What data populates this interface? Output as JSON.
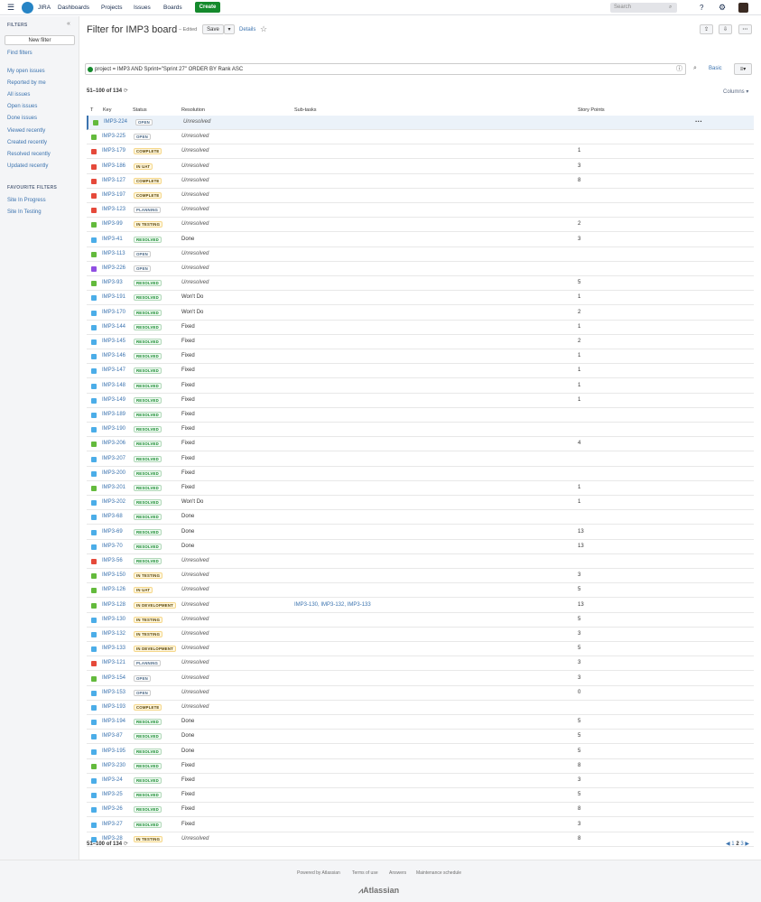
{
  "topnav": {
    "app_name": "JIRA",
    "dashboards": "Dashboards",
    "projects": "Projects",
    "issues": "Issues",
    "boards": "Boards",
    "create": "Create",
    "search_placeholder": "Search"
  },
  "sidebar": {
    "heading": "FILTERS",
    "new_filter": "New filter",
    "find_filters": "Find filters",
    "items": [
      "My open issues",
      "Reported by me",
      "All issues",
      "Open issues",
      "Done issues",
      "Viewed recently",
      "Created recently",
      "Resolved recently",
      "Updated recently"
    ],
    "fav_heading": "FAVOURITE FILTERS",
    "favourites": [
      "Site In Progress",
      "Site In Testing"
    ]
  },
  "main": {
    "title": "Filter for IMP3 board",
    "edited": "– Edited",
    "save": "Save",
    "details": "Details",
    "jql": "project = IMP3 AND Sprint=\"Sprint 27\" ORDER BY Rank ASC",
    "basic": "Basic",
    "count": "51–100 of 134",
    "columns": "Columns",
    "headers": {
      "t": "T",
      "key": "Key",
      "status": "Status",
      "resolution": "Resolution",
      "subtasks": "Sub-tasks",
      "story_points": "Story Points"
    }
  },
  "colors": {
    "story": "#63ba3c",
    "bug": "#e5493a",
    "task": "#4bade8",
    "epic": "#904ee2"
  },
  "rows": [
    {
      "type": "story",
      "key": "IMP3-224",
      "status": "OPEN",
      "resolution": "Unresolved",
      "sub": "",
      "sp": ""
    },
    {
      "type": "story",
      "key": "IMP3-225",
      "status": "OPEN",
      "resolution": "Unresolved",
      "sub": "",
      "sp": ""
    },
    {
      "type": "bug",
      "key": "IMP3-179",
      "status": "COMPLETE",
      "resolution": "Unresolved",
      "sub": "",
      "sp": "1"
    },
    {
      "type": "bug",
      "key": "IMP3-186",
      "status": "IN UAT",
      "resolution": "Unresolved",
      "sub": "",
      "sp": "3"
    },
    {
      "type": "bug",
      "key": "IMP3-127",
      "status": "COMPLETE",
      "resolution": "Unresolved",
      "sub": "",
      "sp": "8"
    },
    {
      "type": "bug",
      "key": "IMP3-197",
      "status": "COMPLETE",
      "resolution": "Unresolved",
      "sub": "",
      "sp": ""
    },
    {
      "type": "bug",
      "key": "IMP3-123",
      "status": "PLANNING",
      "resolution": "Unresolved",
      "sub": "",
      "sp": ""
    },
    {
      "type": "story",
      "key": "IMP3-99",
      "status": "IN TESTING",
      "resolution": "Unresolved",
      "sub": "",
      "sp": "2"
    },
    {
      "type": "task",
      "key": "IMP3-41",
      "status": "RESOLVED",
      "resolution": "Done",
      "sub": "",
      "sp": "3"
    },
    {
      "type": "story",
      "key": "IMP3-113",
      "status": "OPEN",
      "resolution": "Unresolved",
      "sub": "",
      "sp": ""
    },
    {
      "type": "epic",
      "key": "IMP3-226",
      "status": "OPEN",
      "resolution": "Unresolved",
      "sub": "",
      "sp": ""
    },
    {
      "type": "story",
      "key": "IMP3-93",
      "status": "RESOLVED",
      "resolution": "Unresolved",
      "sub": "",
      "sp": "5"
    },
    {
      "type": "task",
      "key": "IMP3-191",
      "status": "RESOLVED",
      "resolution": "Won't Do",
      "sub": "",
      "sp": "1"
    },
    {
      "type": "task",
      "key": "IMP3-170",
      "status": "RESOLVED",
      "resolution": "Won't Do",
      "sub": "",
      "sp": "2"
    },
    {
      "type": "task",
      "key": "IMP3-144",
      "status": "RESOLVED",
      "resolution": "Fixed",
      "sub": "",
      "sp": "1"
    },
    {
      "type": "task",
      "key": "IMP3-145",
      "status": "RESOLVED",
      "resolution": "Fixed",
      "sub": "",
      "sp": "2"
    },
    {
      "type": "task",
      "key": "IMP3-146",
      "status": "RESOLVED",
      "resolution": "Fixed",
      "sub": "",
      "sp": "1"
    },
    {
      "type": "task",
      "key": "IMP3-147",
      "status": "RESOLVED",
      "resolution": "Fixed",
      "sub": "",
      "sp": "1"
    },
    {
      "type": "task",
      "key": "IMP3-148",
      "status": "RESOLVED",
      "resolution": "Fixed",
      "sub": "",
      "sp": "1"
    },
    {
      "type": "task",
      "key": "IMP3-149",
      "status": "RESOLVED",
      "resolution": "Fixed",
      "sub": "",
      "sp": "1"
    },
    {
      "type": "task",
      "key": "IMP3-189",
      "status": "RESOLVED",
      "resolution": "Fixed",
      "sub": "",
      "sp": ""
    },
    {
      "type": "task",
      "key": "IMP3-190",
      "status": "RESOLVED",
      "resolution": "Fixed",
      "sub": "",
      "sp": ""
    },
    {
      "type": "story",
      "key": "IMP3-206",
      "status": "RESOLVED",
      "resolution": "Fixed",
      "sub": "",
      "sp": "4"
    },
    {
      "type": "task",
      "key": "IMP3-207",
      "status": "RESOLVED",
      "resolution": "Fixed",
      "sub": "",
      "sp": ""
    },
    {
      "type": "task",
      "key": "IMP3-200",
      "status": "RESOLVED",
      "resolution": "Fixed",
      "sub": "",
      "sp": ""
    },
    {
      "type": "story",
      "key": "IMP3-201",
      "status": "RESOLVED",
      "resolution": "Fixed",
      "sub": "",
      "sp": "1"
    },
    {
      "type": "task",
      "key": "IMP3-202",
      "status": "RESOLVED",
      "resolution": "Won't Do",
      "sub": "",
      "sp": "1"
    },
    {
      "type": "task",
      "key": "IMP3-68",
      "status": "RESOLVED",
      "resolution": "Done",
      "sub": "",
      "sp": ""
    },
    {
      "type": "task",
      "key": "IMP3-69",
      "status": "RESOLVED",
      "resolution": "Done",
      "sub": "",
      "sp": "13"
    },
    {
      "type": "task",
      "key": "IMP3-70",
      "status": "RESOLVED",
      "resolution": "Done",
      "sub": "",
      "sp": "13"
    },
    {
      "type": "bug",
      "key": "IMP3-56",
      "status": "RESOLVED",
      "resolution": "Unresolved",
      "sub": "",
      "sp": ""
    },
    {
      "type": "story",
      "key": "IMP3-150",
      "status": "IN TESTING",
      "resolution": "Unresolved",
      "sub": "",
      "sp": "3"
    },
    {
      "type": "story",
      "key": "IMP3-126",
      "status": "IN UAT",
      "resolution": "Unresolved",
      "sub": "",
      "sp": "5"
    },
    {
      "type": "story",
      "key": "IMP3-128",
      "status": "IN DEVELOPMENT",
      "resolution": "Unresolved",
      "sub": "IMP3-130, IMP3-132, IMP3-133",
      "sp": "13"
    },
    {
      "type": "task",
      "key": "IMP3-130",
      "status": "IN TESTING",
      "resolution": "Unresolved",
      "sub": "",
      "sp": "5"
    },
    {
      "type": "task",
      "key": "IMP3-132",
      "status": "IN TESTING",
      "resolution": "Unresolved",
      "sub": "",
      "sp": "3"
    },
    {
      "type": "task",
      "key": "IMP3-133",
      "status": "IN DEVELOPMENT",
      "resolution": "Unresolved",
      "sub": "",
      "sp": "5"
    },
    {
      "type": "bug",
      "key": "IMP3-121",
      "status": "PLANNING",
      "resolution": "Unresolved",
      "sub": "",
      "sp": "3"
    },
    {
      "type": "story",
      "key": "IMP3-154",
      "status": "OPEN",
      "resolution": "Unresolved",
      "sub": "",
      "sp": "3"
    },
    {
      "type": "task",
      "key": "IMP3-153",
      "status": "OPEN",
      "resolution": "Unresolved",
      "sub": "",
      "sp": "0"
    },
    {
      "type": "task",
      "key": "IMP3-193",
      "status": "COMPLETE",
      "resolution": "Unresolved",
      "sub": "",
      "sp": ""
    },
    {
      "type": "task",
      "key": "IMP3-194",
      "status": "RESOLVED",
      "resolution": "Done",
      "sub": "",
      "sp": "5"
    },
    {
      "type": "task",
      "key": "IMP3-87",
      "status": "RESOLVED",
      "resolution": "Done",
      "sub": "",
      "sp": "5"
    },
    {
      "type": "task",
      "key": "IMP3-195",
      "status": "RESOLVED",
      "resolution": "Done",
      "sub": "",
      "sp": "5"
    },
    {
      "type": "story",
      "key": "IMP3-230",
      "status": "RESOLVED",
      "resolution": "Fixed",
      "sub": "",
      "sp": "8"
    },
    {
      "type": "task",
      "key": "IMP3-24",
      "status": "RESOLVED",
      "resolution": "Fixed",
      "sub": "",
      "sp": "3"
    },
    {
      "type": "task",
      "key": "IMP3-25",
      "status": "RESOLVED",
      "resolution": "Fixed",
      "sub": "",
      "sp": "5"
    },
    {
      "type": "task",
      "key": "IMP3-26",
      "status": "RESOLVED",
      "resolution": "Fixed",
      "sub": "",
      "sp": "8"
    },
    {
      "type": "task",
      "key": "IMP3-27",
      "status": "RESOLVED",
      "resolution": "Fixed",
      "sub": "",
      "sp": "3"
    },
    {
      "type": "task",
      "key": "IMP3-28",
      "status": "IN TESTING",
      "resolution": "Unresolved",
      "sub": "",
      "sp": "8"
    }
  ],
  "pager": {
    "prev": "◀",
    "pages": [
      "1",
      "2",
      "3"
    ],
    "current": "2",
    "next": "▶"
  },
  "footer": {
    "powered": "Powered by Atlassian",
    "terms": "Terms of use",
    "answers": "Answers",
    "maintenance": "Maintenance schedule",
    "brand": "Atlassian"
  }
}
